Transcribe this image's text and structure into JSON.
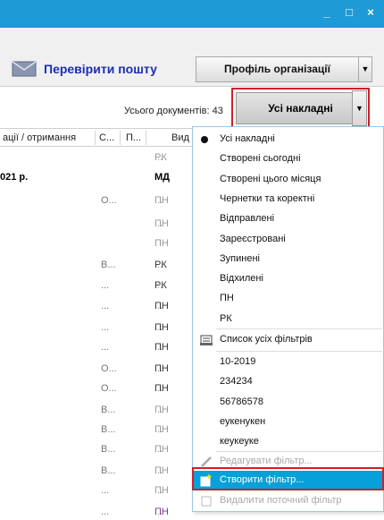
{
  "window": {
    "controls": [
      "_",
      "□",
      "×"
    ]
  },
  "toolbar": {
    "mail_label": "Перевірити пошту",
    "org_label": "Профіль організації",
    "org_arrow": "▼"
  },
  "list": {
    "doc_count": "Усього документів: 43",
    "filter_label": "Усі накладні",
    "filter_arrow": "▼",
    "headers": [
      "ації / отримання",
      "С...",
      "П...",
      "Вид"
    ],
    "rows": [
      {
        "c1": "",
        "c2": "",
        "c3": "...",
        "c4": "РК",
        "c4style": ""
      },
      {
        "c1": "021 р.",
        "c2": "",
        "c3": "",
        "c4": "МД",
        "c4style": "bold"
      },
      {
        "c1": "",
        "c2": "О...",
        "c3": "...",
        "c4": "ПН",
        "c4style": ""
      },
      {
        "c1": "",
        "c2": "",
        "c3": "...",
        "c4": "ПН",
        "c4style": ""
      },
      {
        "c1": "",
        "c2": "",
        "c3": "",
        "c4": "ПН",
        "c4style": ""
      },
      {
        "c1": "",
        "c2": "В...",
        "c3": "...",
        "c4": "РК",
        "c4style": "dark"
      },
      {
        "c1": "",
        "c2": "...",
        "c3": "...",
        "c4": "РК",
        "c4style": "dark"
      },
      {
        "c1": "",
        "c2": "...",
        "c3": "...",
        "c4": "ПН",
        "c4style": "dark"
      },
      {
        "c1": "",
        "c2": "...",
        "c3": "...",
        "c4": "ПН",
        "c4style": "dark"
      },
      {
        "c1": "",
        "c2": "...",
        "c3": "...",
        "c4": "ПН",
        "c4style": "dark"
      },
      {
        "c1": "",
        "c2": "О...",
        "c3": "...",
        "c4": "ПН",
        "c4style": "dark"
      },
      {
        "c1": "",
        "c2": "О...",
        "c3": "...",
        "c4": "ПН",
        "c4style": "dark"
      },
      {
        "c1": "",
        "c2": "В...",
        "c3": "...",
        "c4": "ПН",
        "c4style": ""
      },
      {
        "c1": "",
        "c2": "В...",
        "c3": "...",
        "c4": "ПН",
        "c4style": ""
      },
      {
        "c1": "",
        "c2": "В...",
        "c3": "...",
        "c4": "ПН",
        "c4style": ""
      },
      {
        "c1": "",
        "c2": "В...",
        "c3": "...",
        "c4": "ПН",
        "c4style": ""
      },
      {
        "c1": "",
        "c2": "...",
        "c3": "...",
        "c4": "ПН",
        "c4style": ""
      },
      {
        "c1": "",
        "c2": "...",
        "c3": "...",
        "c4": "ПН",
        "c4style": "purple"
      }
    ]
  },
  "menu": {
    "items": [
      {
        "label": "Усі накладні",
        "kind": "radio"
      },
      {
        "label": "Створені сьогодні"
      },
      {
        "label": "Створені цього місяця"
      },
      {
        "label": "Чернетки та коректні"
      },
      {
        "label": "Відправлені"
      },
      {
        "label": "Зареєстровані"
      },
      {
        "label": "Зупинені"
      },
      {
        "label": "Відхилені"
      },
      {
        "label": "ПН"
      },
      {
        "label": "РК"
      }
    ],
    "all_filters": "Список усіх фільтрів",
    "saved": [
      "10-2019",
      "234234",
      "56786578",
      "еукенукен",
      "кеукеуке"
    ],
    "edit": "Редагувати фільтр...",
    "create": "Створити фільтр...",
    "delete": "Видалити поточний фільтр"
  }
}
